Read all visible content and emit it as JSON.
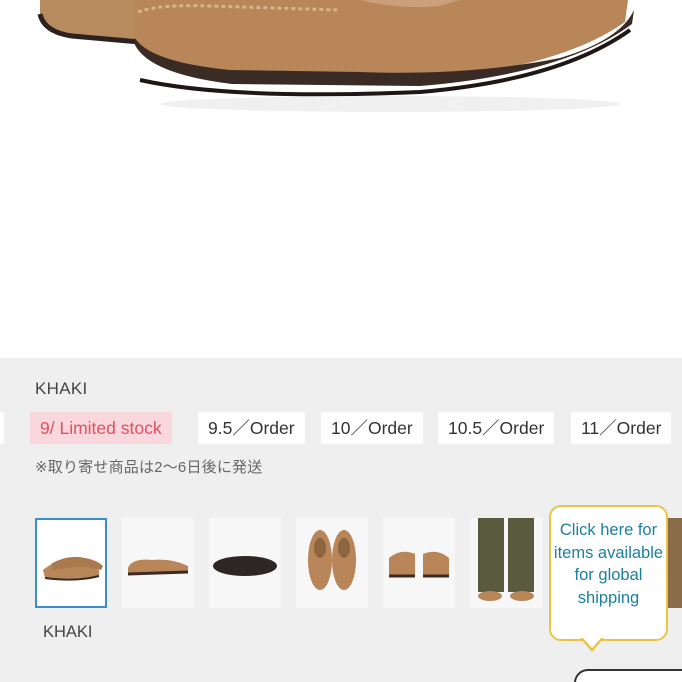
{
  "product": {
    "color_label": "KHAKI",
    "sizes": [
      {
        "label": "er",
        "state": "order"
      },
      {
        "label": "9/ Limited stock",
        "state": "limited"
      },
      {
        "label": "9.5／Order",
        "state": "order"
      },
      {
        "label": "10／Order",
        "state": "order"
      },
      {
        "label": "10.5／Order",
        "state": "order"
      },
      {
        "label": "11／Order",
        "state": "order"
      }
    ],
    "note": "※取り寄せ商品は2〜6日後に発送",
    "thumbnails": [
      {
        "icon": "shoe-pair-angle-thumb",
        "selected": true
      },
      {
        "icon": "shoe-side-thumb",
        "selected": false
      },
      {
        "icon": "shoe-sole-thumb",
        "selected": false
      },
      {
        "icon": "shoe-top-pair-thumb",
        "selected": false
      },
      {
        "icon": "shoe-back-thumb",
        "selected": false
      },
      {
        "icon": "model-legs-thumb",
        "selected": false
      }
    ],
    "thumb_caption": "KHAKI"
  },
  "global_shipping": {
    "label": "Click here for items available for global shipping"
  },
  "colors": {
    "panel_bg": "#efefef",
    "limited_bg": "#f9d7dc",
    "limited_text": "#e0525f",
    "selected_border": "#3a8fc8",
    "bubble_border": "#e8c44a",
    "bubble_text": "#1d7f9e"
  }
}
